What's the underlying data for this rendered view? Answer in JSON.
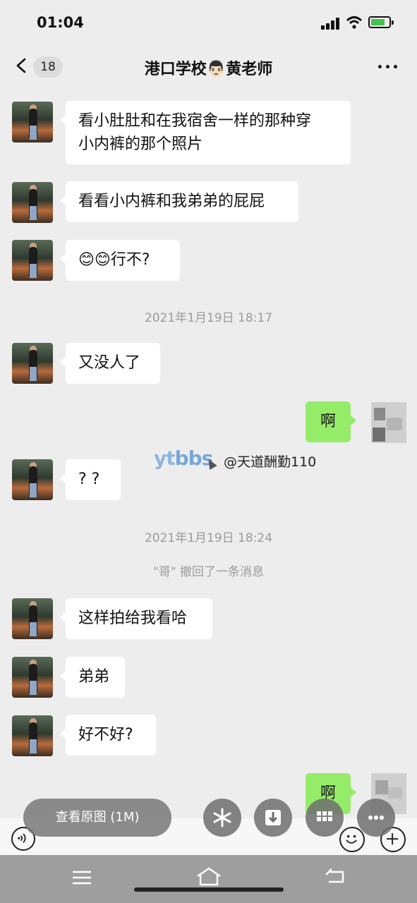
{
  "status_bar": {
    "time": "01:04"
  },
  "header": {
    "unread_count": "18",
    "title": "港口学校👨🏻黄老师"
  },
  "messages": [
    {
      "text_line1": "看小肚肚和在我宿舍一样的那种穿",
      "text_line2": "小内裤的那个照片"
    },
    {
      "text": "看看小内裤和我弟弟的屁屁"
    },
    {
      "text": "😊😊行不?"
    },
    {
      "text": "又没人了"
    },
    {
      "text": "啊"
    },
    {
      "text": "? ?"
    },
    {
      "text": "这样拍给我看哈"
    },
    {
      "text": "弟弟"
    },
    {
      "text": "好不好?"
    },
    {
      "text": "啊"
    }
  ],
  "timestamps": [
    "2021年1月19日 18:17",
    "2021年1月19日 18:24"
  ],
  "system_notice": "\"哥\" 撤回了一条消息",
  "watermark": {
    "logo_a": "yt",
    "logo_b": "bbs",
    "handle": "@天道酬勤110"
  },
  "image_view": {
    "view_original_label": "查看原图 (1M)"
  },
  "colors": {
    "my_bubble": "#95ec69",
    "their_bubble": "#ffffff",
    "background": "#ededed"
  }
}
